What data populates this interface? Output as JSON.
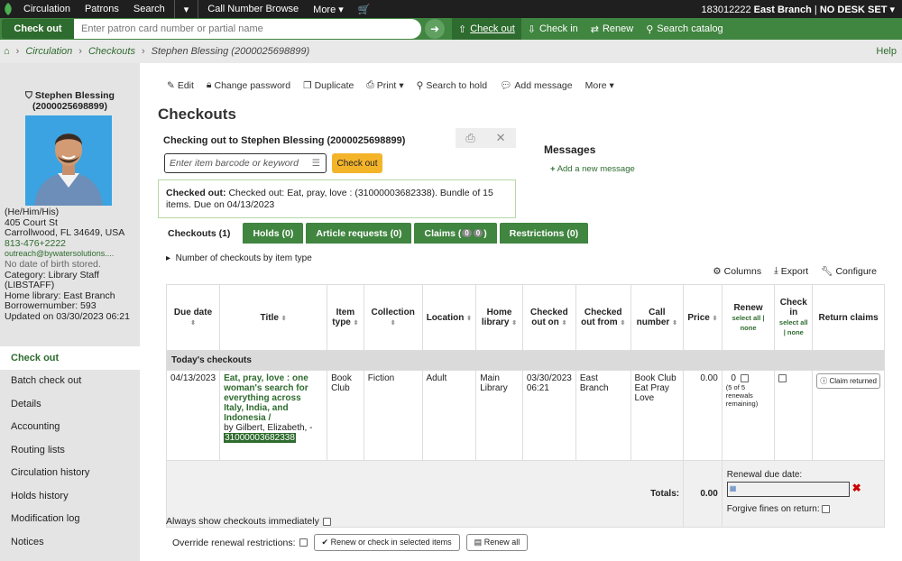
{
  "topnav": {
    "items": [
      "Circulation",
      "Patrons",
      "Search",
      "Call Number Browse",
      "More",
      "183012222",
      "East Branch",
      "NO DESK SET"
    ]
  },
  "searchbar": {
    "label": "Check out",
    "placeholder": "Enter patron card number or partial name",
    "actions": [
      "Check out",
      "Check in",
      "Renew",
      "Search catalog"
    ]
  },
  "breadcrumbs": {
    "items": [
      "Circulation",
      "Checkouts",
      "Stephen Blessing (2000025698899)"
    ],
    "help": "Help"
  },
  "patron": {
    "name": "Stephen Blessing",
    "cardnumber": "(2000025698899)",
    "pronouns": "(He/Him/His)",
    "address1": "405 Court St",
    "address2": "Carrollwood, FL 34649, USA",
    "phone": "813-476+2222",
    "email": "outreach@bywatersolutions....",
    "dob": "No date of birth stored.",
    "category": "Category: Library Staff",
    "category_code": "(LIBSTAFF)",
    "home_library": "Home library: East Branch",
    "borrowernumber": "Borrowernumber: 593",
    "updated": "Updated on 03/30/2023 06:21"
  },
  "leftnav": [
    "Check out",
    "Batch check out",
    "Details",
    "Accounting",
    "Routing lists",
    "Circulation history",
    "Holds history",
    "Modification log",
    "Notices"
  ],
  "toolbar": [
    "Edit",
    "Change password",
    "Duplicate",
    "Print",
    "Search to hold",
    "Add message",
    "More"
  ],
  "page_title": "Checkouts",
  "checkout_box": {
    "heading": "Checking out to Stephen Blessing (2000025698899)",
    "placeholder": "Enter item barcode or keyword",
    "button": "Check out"
  },
  "checked_msg": "Checked out: Eat, pray, love : (31000003682338). Bundle of 15 items. Due on 04/13/2023",
  "messages": {
    "title": "Messages",
    "add": "Add a new message"
  },
  "tabs": [
    {
      "label": "Checkouts (1)"
    },
    {
      "label": "Holds (0)"
    },
    {
      "label": "Article requests (0)"
    },
    {
      "label": "Claims ("
    },
    {
      "label": "Restrictions (0)"
    }
  ],
  "claims_counts": [
    "0",
    "0"
  ],
  "claims_close": ")",
  "panel": {
    "toggle": "Number of checkouts by item type",
    "tools": [
      "Columns",
      "Export",
      "Configure"
    ]
  },
  "table": {
    "headers": [
      "Due date",
      "Title",
      "Item type",
      "Collection",
      "Location",
      "Home library",
      "Checked out on",
      "Checked out from",
      "Call number",
      "Price",
      "Renew",
      "Check in",
      "Return claims"
    ],
    "renew_sub": "select all | none",
    "checkin_sub": "select all | none",
    "section": "Today's checkouts",
    "row": {
      "due": "04/13/2023",
      "title": "Eat, pray, love : one woman's search for everything across Italy, India, and Indonesia /",
      "author": "by Gilbert, Elizabeth, -",
      "barcode": "31000003682338",
      "itype": "Book Club",
      "collection": "Fiction",
      "location": "Adult",
      "home": "Main Library",
      "checked_on": "03/30/2023 06:21",
      "checked_from": "East Branch",
      "callnumber": "Book Club Eat Pray Love",
      "price": "0.00",
      "renew_count": "0",
      "renew_remaining": "(5 of 5 renewals remaining)",
      "claim": "Claim returned"
    },
    "totals_label": "Totals:",
    "totals_value": "0.00",
    "renewal_due": "Renewal due date:",
    "forgive": "Forgive fines on return:"
  },
  "bottom": {
    "always_show": "Always show checkouts immediately",
    "override": "Override renewal restrictions:",
    "renew_selected": "Renew or check in selected items",
    "renew_all": "Renew all"
  }
}
